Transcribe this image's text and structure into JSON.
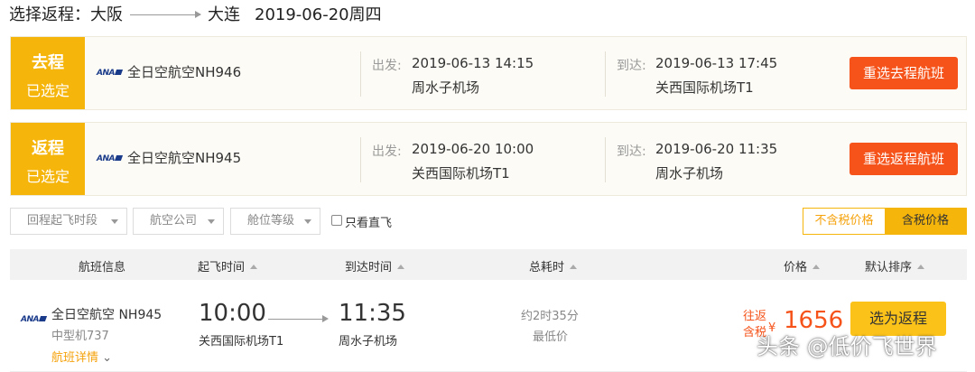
{
  "header": {
    "prefix": "选择返程：",
    "from": "大阪",
    "to": "大连",
    "date": "2019-06-20周四"
  },
  "outbound": {
    "badge_title": "去程",
    "badge_sub": "已选定",
    "ana_logo": "ANA",
    "airline": "全日空航空NH946",
    "depart_label": "出发:",
    "depart_time": "2019-06-13 14:15",
    "depart_airport": "周水子机场",
    "arrive_label": "到达:",
    "arrive_time": "2019-06-13 17:45",
    "arrive_airport": "关西国际机场T1",
    "button": "重选去程航班"
  },
  "return": {
    "badge_title": "返程",
    "badge_sub": "已选定",
    "ana_logo": "ANA",
    "airline": "全日空航空NH945",
    "depart_label": "出发:",
    "depart_time": "2019-06-20 10:00",
    "depart_airport": "关西国际机场T1",
    "arrive_label": "到达:",
    "arrive_time": "2019-06-20 11:35",
    "arrive_airport": "周水子机场",
    "button": "重选返程航班"
  },
  "filters": {
    "time": "回程起飞时段",
    "airline": "航空公司",
    "cabin": "舱位等级",
    "direct_only": "只看直飞",
    "tax_excl": "不含税价格",
    "tax_incl": "含税价格"
  },
  "columns": {
    "info": "航班信息",
    "depart": "起飞时间",
    "arrive": "到达时间",
    "duration": "总耗时",
    "price": "价格",
    "sort": "默认排序"
  },
  "result": {
    "ana_logo": "ANA",
    "airline": "全日空航空 NH945",
    "aircraft": "中型机737",
    "details": "航班详情",
    "depart_time": "10:00",
    "depart_airport": "关西国际机场T1",
    "arrive_time": "11:35",
    "arrive_airport": "周水子机场",
    "duration": "约2时35分",
    "lowest": "最低价",
    "price_tag1": "往返",
    "price_tag2": "含税",
    "currency": "¥",
    "price": "1656",
    "button": "选为返程"
  },
  "watermark": "头条 @低价飞世界",
  "colors": {
    "accent_yellow": "#f5b50b",
    "button_red": "#f5531a",
    "button_yellow": "#fbc21a"
  },
  "icons": [
    "ana-logo-icon",
    "caret-down-icon",
    "arrow-right-icon",
    "sort-up-icon"
  ]
}
